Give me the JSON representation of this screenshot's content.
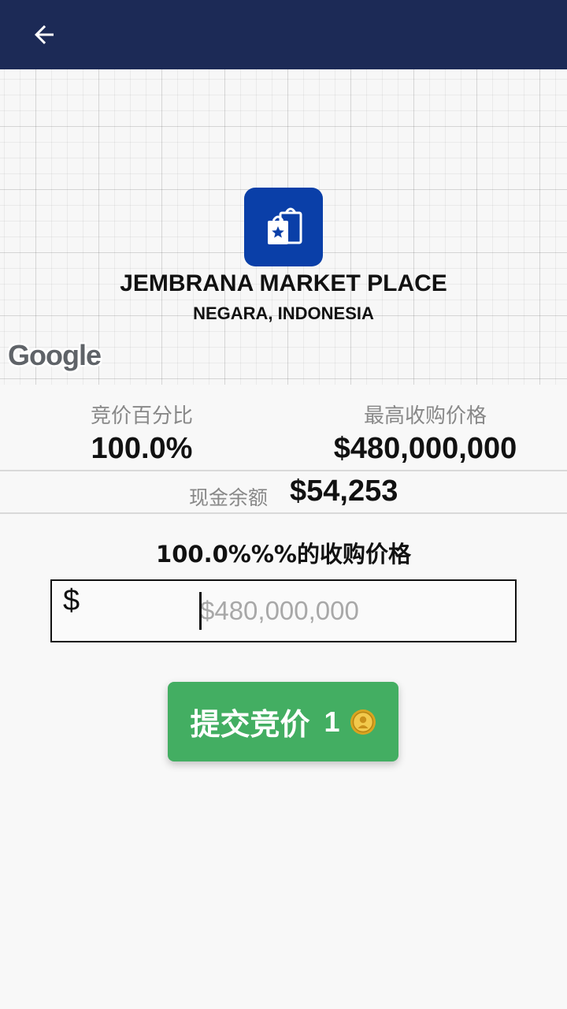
{
  "place": {
    "name": "JEMBRANA MARKET PLACE",
    "location": "NEGARA, INDONESIA",
    "icon": "shopping-bag-star-icon",
    "icon_color": "#0a3fa8"
  },
  "map": {
    "attribution": "Google"
  },
  "stats": {
    "bid_percentage_label": "竞价百分比",
    "bid_percentage_value": "100.0%",
    "max_price_label": "最高收购价格",
    "max_price_value": "$480,000,000",
    "cash_label": "现金余额",
    "cash_value": "$54,253"
  },
  "bid_form": {
    "heading": "100.0%%%的收购价格",
    "currency_symbol": "$",
    "placeholder": "$480,000,000",
    "value": ""
  },
  "submit": {
    "label": "提交竞价",
    "cost": "1",
    "cost_icon": "gold-coin-icon",
    "color": "#43ae62"
  },
  "appbar": {
    "color": "#1c2a56",
    "back_icon": "arrow-left-icon"
  }
}
